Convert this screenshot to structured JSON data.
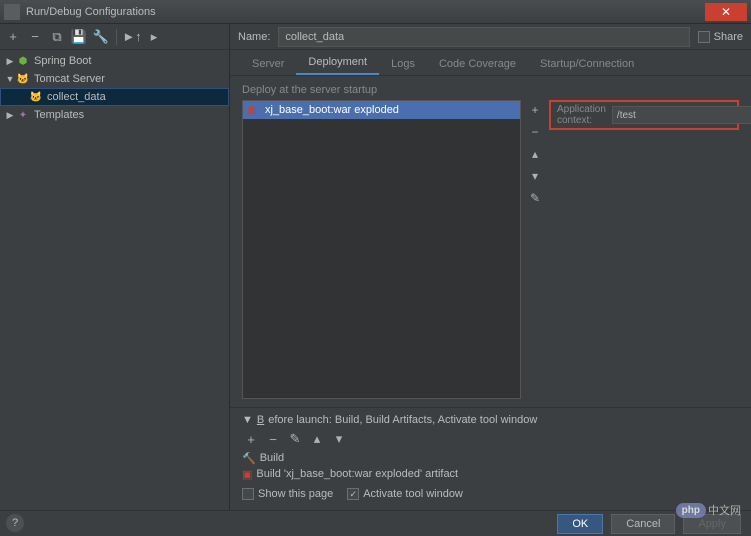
{
  "window": {
    "title": "Run/Debug Configurations"
  },
  "nameField": {
    "label": "Name:",
    "value": "collect_data"
  },
  "share": {
    "label": "Share"
  },
  "sidebar": {
    "items": [
      {
        "label": "Spring Boot",
        "expanded": false
      },
      {
        "label": "Tomcat Server",
        "expanded": true
      },
      {
        "label": "collect_data",
        "child": true,
        "selected": true
      },
      {
        "label": "Templates",
        "expanded": false
      }
    ]
  },
  "tabs": [
    {
      "label": "Server"
    },
    {
      "label": "Deployment",
      "active": true
    },
    {
      "label": "Logs"
    },
    {
      "label": "Code Coverage"
    },
    {
      "label": "Startup/Connection"
    }
  ],
  "deploy": {
    "section_label": "Deploy at the server startup",
    "artifact": "xj_base_boot:war exploded",
    "context_label": "Application context:",
    "context_value": "/test"
  },
  "beforeLaunch": {
    "header": "Before launch: Build, Build Artifacts, Activate tool window",
    "items": [
      {
        "label": "Build"
      },
      {
        "label": "Build 'xj_base_boot:war exploded' artifact"
      }
    ],
    "show_page": "Show this page",
    "activate": "Activate tool window"
  },
  "buttons": {
    "ok": "OK",
    "cancel": "Cancel",
    "apply": "Apply"
  },
  "watermark": {
    "badge": "php",
    "text": "中文网"
  }
}
